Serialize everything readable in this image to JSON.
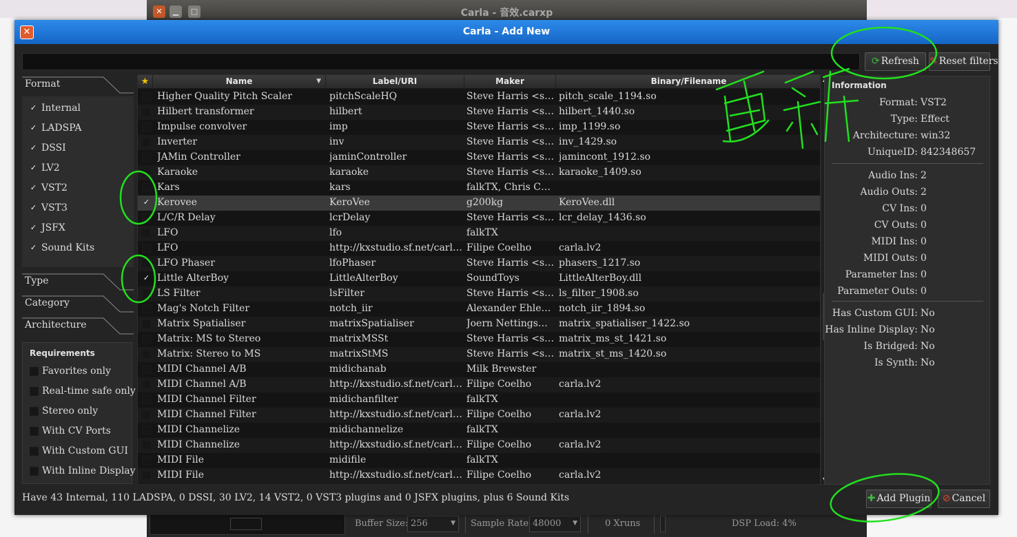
{
  "bg_window": {
    "title": "Carla - 音效.carxp",
    "statusbar": {
      "buffer_size_label": "Buffer Size:",
      "buffer_size_value": "256",
      "sample_rate_label": "Sample Rate:",
      "sample_rate_value": "48000",
      "xruns": "0 Xruns",
      "dsp_load": "DSP Load: 4%"
    }
  },
  "dialog": {
    "title": "Carla - Add New",
    "close_icon": "close-icon",
    "buttons": {
      "refresh": "Refresh",
      "reset_filters": "Reset filters",
      "add_plugin": "Add Plugin",
      "cancel": "Cancel"
    }
  },
  "filters": {
    "format_label": "Format",
    "formats": [
      {
        "label": "Internal",
        "checked": true
      },
      {
        "label": "LADSPA",
        "checked": true
      },
      {
        "label": "DSSI",
        "checked": true
      },
      {
        "label": "LV2",
        "checked": true
      },
      {
        "label": "VST2",
        "checked": true
      },
      {
        "label": "VST3",
        "checked": true
      },
      {
        "label": "JSFX",
        "checked": true
      },
      {
        "label": "Sound Kits",
        "checked": true
      }
    ],
    "type_label": "Type",
    "category_label": "Category",
    "architecture_label": "Architecture",
    "requirements_label": "Requirements",
    "requirements": [
      {
        "label": "Favorites only",
        "checked": false
      },
      {
        "label": "Real-time safe only",
        "checked": false
      },
      {
        "label": "Stereo only",
        "checked": false
      },
      {
        "label": "With CV Ports",
        "checked": false
      },
      {
        "label": "With Custom GUI",
        "checked": false
      },
      {
        "label": "With Inline Display",
        "checked": false
      }
    ]
  },
  "table": {
    "columns": [
      "Name",
      "Label/URI",
      "Maker",
      "Binary/Filename"
    ],
    "favorite_icon": "star-icon",
    "rows": [
      {
        "fav": false,
        "name": "Higher Quality Pitch Scaler",
        "label": "pitchScaleHQ",
        "maker": "Steve Harris <stev…",
        "binary": "pitch_scale_1194.so"
      },
      {
        "fav": false,
        "name": "Hilbert transformer",
        "label": "hilbert",
        "maker": "Steve Harris <stev…",
        "binary": "hilbert_1440.so"
      },
      {
        "fav": false,
        "name": "Impulse convolver",
        "label": "imp",
        "maker": "Steve Harris <stev…",
        "binary": "imp_1199.so"
      },
      {
        "fav": false,
        "name": "Inverter",
        "label": "inv",
        "maker": "Steve Harris <stev…",
        "binary": "inv_1429.so"
      },
      {
        "fav": false,
        "name": "JAMin Controller",
        "label": "jaminController",
        "maker": "Steve Harris <stev…",
        "binary": "jamincont_1912.so"
      },
      {
        "fav": false,
        "name": "Karaoke",
        "label": "karaoke",
        "maker": "Steve Harris <stev…",
        "binary": "karaoke_1409.so"
      },
      {
        "fav": false,
        "name": "Kars",
        "label": "kars",
        "maker": "falkTX, Chris Cann…",
        "binary": ""
      },
      {
        "fav": true,
        "name": "Kerovee",
        "label": "KeroVee",
        "maker": "g200kg",
        "binary": "KeroVee.dll",
        "selected": true
      },
      {
        "fav": false,
        "name": "L/C/R Delay",
        "label": "lcrDelay",
        "maker": "Steve Harris <stev…",
        "binary": "lcr_delay_1436.so"
      },
      {
        "fav": false,
        "name": "LFO",
        "label": "lfo",
        "maker": "falkTX",
        "binary": ""
      },
      {
        "fav": false,
        "name": "LFO",
        "label": "http://kxstudio.sf.net/carla/plu…",
        "maker": "Filipe Coelho",
        "binary": "carla.lv2"
      },
      {
        "fav": false,
        "name": "LFO Phaser",
        "label": "lfoPhaser",
        "maker": "Steve Harris <stev…",
        "binary": "phasers_1217.so"
      },
      {
        "fav": true,
        "name": "Little AlterBoy",
        "label": "LittleAlterBoy",
        "maker": "SoundToys",
        "binary": "LittleAlterBoy.dll"
      },
      {
        "fav": false,
        "name": "LS Filter",
        "label": "lsFilter",
        "maker": "Steve Harris <stev…",
        "binary": "ls_filter_1908.so"
      },
      {
        "fav": false,
        "name": "Mag's Notch Filter",
        "label": "notch_iir",
        "maker": "Alexander Ehlert …",
        "binary": "notch_iir_1894.so"
      },
      {
        "fav": false,
        "name": "Matrix Spatialiser",
        "label": "matrixSpatialiser",
        "maker": "Joern Nettingsmeie…",
        "binary": "matrix_spatialiser_1422.so"
      },
      {
        "fav": false,
        "name": "Matrix: MS to Stereo",
        "label": "matrixMSSt",
        "maker": "Steve Harris <stev…",
        "binary": "matrix_ms_st_1421.so"
      },
      {
        "fav": false,
        "name": "Matrix: Stereo to MS",
        "label": "matrixStMS",
        "maker": "Steve Harris <stev…",
        "binary": "matrix_st_ms_1420.so"
      },
      {
        "fav": false,
        "name": "MIDI Channel A/B",
        "label": "midichanab",
        "maker": "Milk Brewster",
        "binary": ""
      },
      {
        "fav": false,
        "name": "MIDI Channel A/B",
        "label": "http://kxstudio.sf.net/carla/plu…",
        "maker": "Filipe Coelho",
        "binary": "carla.lv2"
      },
      {
        "fav": false,
        "name": "MIDI Channel Filter",
        "label": "midichanfilter",
        "maker": "falkTX",
        "binary": ""
      },
      {
        "fav": false,
        "name": "MIDI Channel Filter",
        "label": "http://kxstudio.sf.net/carla/plu…",
        "maker": "Filipe Coelho",
        "binary": "carla.lv2"
      },
      {
        "fav": false,
        "name": "MIDI Channelize",
        "label": "midichannelize",
        "maker": "falkTX",
        "binary": ""
      },
      {
        "fav": false,
        "name": "MIDI Channelize",
        "label": "http://kxstudio.sf.net/carla/plu…",
        "maker": "Filipe Coelho",
        "binary": "carla.lv2"
      },
      {
        "fav": false,
        "name": "MIDI File",
        "label": "midifile",
        "maker": "falkTX",
        "binary": ""
      },
      {
        "fav": false,
        "name": "MIDI File",
        "label": "http://kxstudio.sf.net/carla/plu…",
        "maker": "Filipe Coelho",
        "binary": "carla.lv2"
      }
    ]
  },
  "info": {
    "title": "Information",
    "group1": [
      {
        "key": "Format:",
        "value": "VST2"
      },
      {
        "key": "Type:",
        "value": "Effect"
      },
      {
        "key": "Architecture:",
        "value": "win32"
      },
      {
        "key": "UniqueID:",
        "value": "842348657"
      }
    ],
    "group2": [
      {
        "key": "Audio Ins:",
        "value": "2"
      },
      {
        "key": "Audio Outs:",
        "value": "2"
      },
      {
        "key": "CV Ins:",
        "value": "0"
      },
      {
        "key": "CV Outs:",
        "value": "0"
      },
      {
        "key": "MIDI Ins:",
        "value": "0"
      },
      {
        "key": "MIDI Outs:",
        "value": "0"
      },
      {
        "key": "Parameter Ins:",
        "value": "0"
      },
      {
        "key": "Parameter Outs:",
        "value": "0"
      }
    ],
    "group3": [
      {
        "key": "Has Custom GUI:",
        "value": "No"
      },
      {
        "key": "Has Inline Display:",
        "value": "No"
      },
      {
        "key": "Is Bridged:",
        "value": "No"
      },
      {
        "key": "Is Synth:",
        "value": "No"
      }
    ]
  },
  "status_text": "Have 43 Internal, 110 LADSPA, 0 DSSI, 30 LV2, 14 VST2, 0 VST3 plugins and 0 JSFX plugins, plus 6 Sound Kits",
  "annotation": {
    "handwriting": "更新",
    "color": "#22e01e"
  },
  "colors": {
    "titlebar_blue": "#1e78dc",
    "panel_dark": "#242424",
    "table_bg": "#141414",
    "selected_row": "#3a3a3a"
  }
}
